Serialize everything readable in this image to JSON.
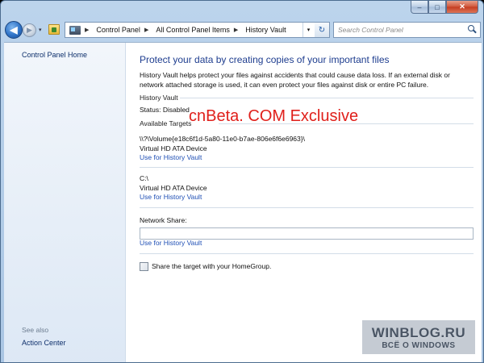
{
  "window": {
    "caption_buttons": {
      "minimize": "–",
      "maximize": "□",
      "close": "✕"
    }
  },
  "nav": {
    "back_glyph": "◀",
    "forward_glyph": "▶",
    "dropdown_glyph": "▾",
    "breadcrumb": [
      "Control Panel",
      "All Control Panel Items",
      "History Vault"
    ],
    "breadcrumb_sep": "▶",
    "refresh_glyph": "↻",
    "address_drop_glyph": "▾",
    "search_placeholder": "Search Control Panel"
  },
  "sidebar": {
    "home_link": "Control Panel Home",
    "see_also": "See also",
    "action_center": "Action Center"
  },
  "main": {
    "title": "Protect your data by creating copies of your important files",
    "description": "History Vault helps protect your files against accidents that could cause data loss. If an external disk or network attached storage is used, it can even protect your files against disk or entire PC failure.",
    "section_history_vault": "History Vault",
    "status": "Status: Disabled",
    "available_targets": "Available Targets",
    "targets": [
      {
        "path": "\\\\?\\Volume{e18c6f1d-5a80-11e0-b7ae-806e6f6e6963}\\",
        "device": "Virtual HD ATA Device",
        "action": "Use for History Vault"
      },
      {
        "path": "C:\\",
        "device": "Virtual HD ATA Device",
        "action": "Use for History Vault"
      }
    ],
    "network_share_label": "Network Share:",
    "network_share_value": "",
    "network_share_action": "Use for History Vault",
    "homegroup_checkbox_label": "Share the target with your HomeGroup.",
    "homegroup_checked": false
  },
  "overlays": {
    "watermark": "cnBeta. COM Exclusive",
    "winblog_title": "WINBLOG.RU",
    "winblog_sub": "ВСЁ О WINDOWS"
  },
  "colors": {
    "title_blue": "#1e3d8f",
    "link_blue": "#1f4fb5",
    "watermark_red": "#e0201b"
  }
}
